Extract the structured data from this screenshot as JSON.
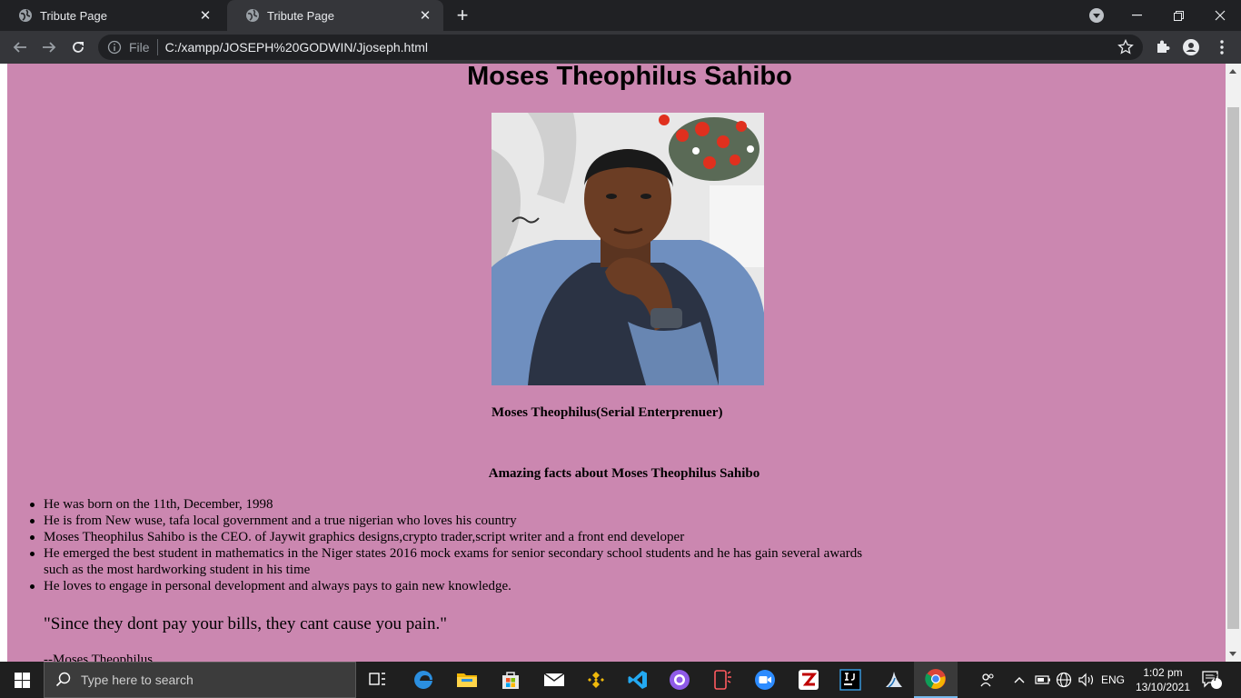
{
  "browser": {
    "tabs": [
      {
        "title": "Tribute Page",
        "active": false
      },
      {
        "title": "Tribute Page",
        "active": true
      }
    ],
    "address": {
      "scheme_label": "File",
      "url": "C:/xampp/JOSEPH%20GODWIN/Jjoseph.html"
    }
  },
  "page": {
    "heading": "Moses Theophilus Sahibo",
    "image_caption": "Moses Theophilus(Serial Enterprenuer)",
    "facts_heading": "Amazing facts about Moses Theophilus Sahibo",
    "facts": [
      "He was born on the 11th, December, 1998",
      "He is from New wuse, tafa local government and a true nigerian who loves his country",
      "Moses Theophilus Sahibo is the CEO. of Jaywit graphics designs,crypto trader,script writer and a front end developer",
      "He emerged the best student in mathematics in the Niger states 2016 mock exams for senior secondary school students and he has gain several awards such as the most hardworking student in his time",
      "He loves to engage in personal development and always pays to gain new knowledge."
    ],
    "quote": "\"Since they dont pay your bills, they cant cause you pain.\"",
    "attribution": "--Moses Theophilus",
    "background_color": "#cb87b0"
  },
  "taskbar": {
    "search_placeholder": "Type here to search",
    "language": "ENG",
    "time": "1:02 pm",
    "date": "13/10/2021",
    "notification_count": "7",
    "apps": [
      "task-view",
      "edge",
      "file-explorer",
      "microsoft-store",
      "mail",
      "binance",
      "vscode",
      "github-desktop",
      "phone-app",
      "zoom",
      "filezilla-pro",
      "intellij",
      "wireshark",
      "chrome"
    ]
  }
}
